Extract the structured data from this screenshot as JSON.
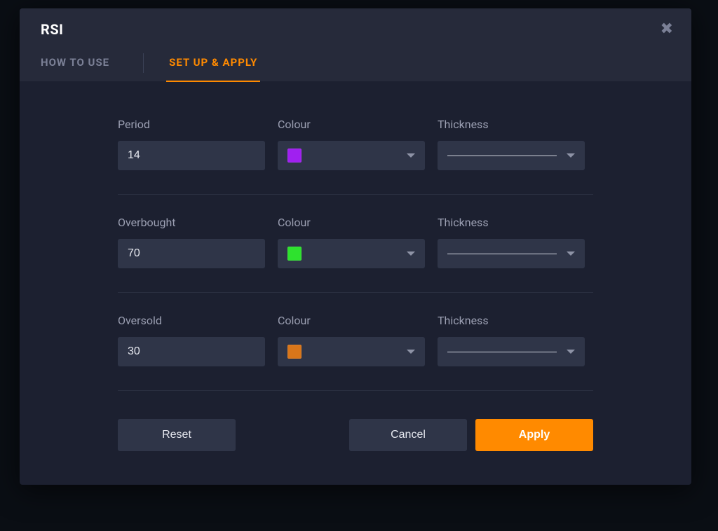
{
  "modal": {
    "title": "RSI",
    "close_icon": "✖"
  },
  "tabs": [
    {
      "id": "howto",
      "label": "HOW TO USE",
      "active": false
    },
    {
      "id": "setup",
      "label": "SET UP & APPLY",
      "active": true
    }
  ],
  "labels": {
    "colour": "Colour",
    "thickness": "Thickness"
  },
  "rows": [
    {
      "id": "period",
      "param_label": "Period",
      "value": "14",
      "colour": "#a020f0",
      "thickness": "1"
    },
    {
      "id": "overbought",
      "param_label": "Overbought",
      "value": "70",
      "colour": "#2ee22e",
      "thickness": "1"
    },
    {
      "id": "oversold",
      "param_label": "Oversold",
      "value": "30",
      "colour": "#d9761a",
      "thickness": "1"
    }
  ],
  "footer": {
    "reset": "Reset",
    "cancel": "Cancel",
    "apply": "Apply"
  }
}
